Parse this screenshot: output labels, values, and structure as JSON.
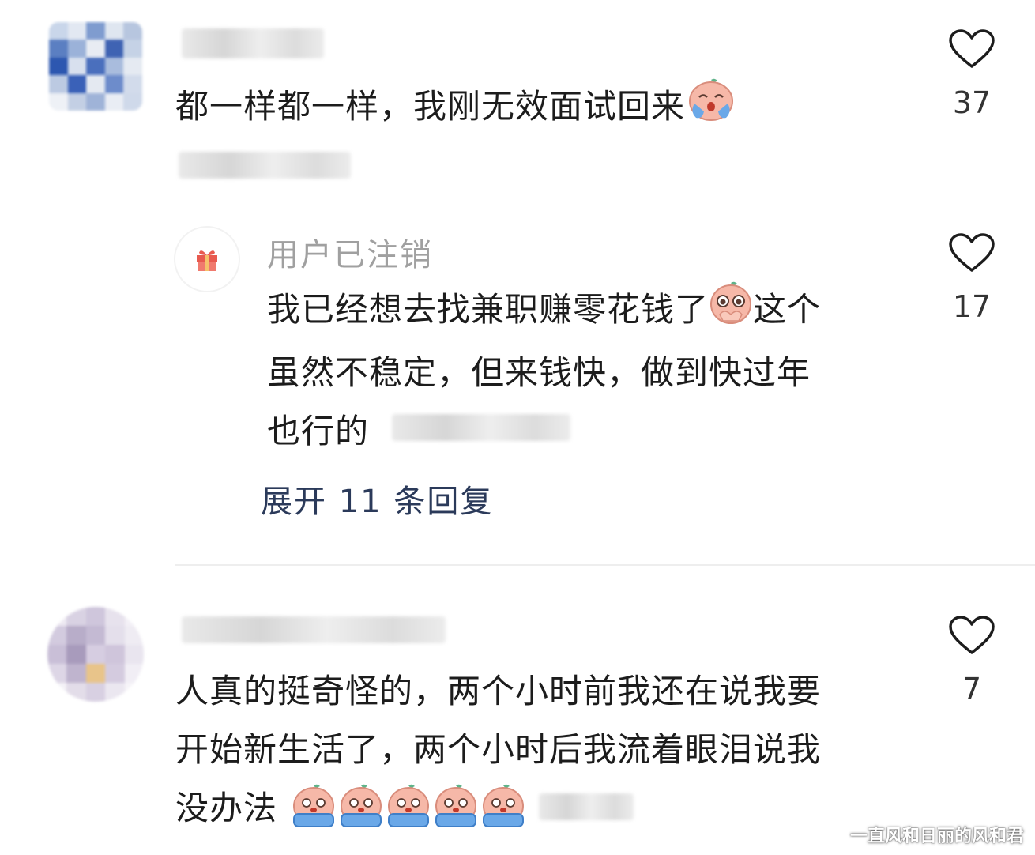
{
  "comments": [
    {
      "text": "都一样都一样，我刚无效面试回来",
      "likes": "37",
      "emoji": "crying-face-emoji"
    },
    {
      "username": "用户已注销",
      "lines": [
        "我已经想去找兼职赚零花钱了",
        "这个",
        "虽然不稳定，但来钱快，做到快过年",
        "也行的"
      ],
      "likes": "17",
      "emoji": "pleading-face-emoji",
      "expand_label": "展开 11 条回复"
    },
    {
      "lines": [
        "人真的挺奇怪的，两个小时前我还在说我要",
        "开始新生活了，两个小时后我流着眼泪说我",
        "没办法"
      ],
      "likes": "7",
      "emoji": "sobbing-face-emoji"
    }
  ],
  "watermark": "一直风和日丽的风和君",
  "colors": {
    "text": "#1c1c1c",
    "username_deleted": "#a0a0a0",
    "expand_link": "#2b3a5a",
    "emoji_face": "#f6b8a8",
    "emoji_tear": "#6aa8e8"
  }
}
